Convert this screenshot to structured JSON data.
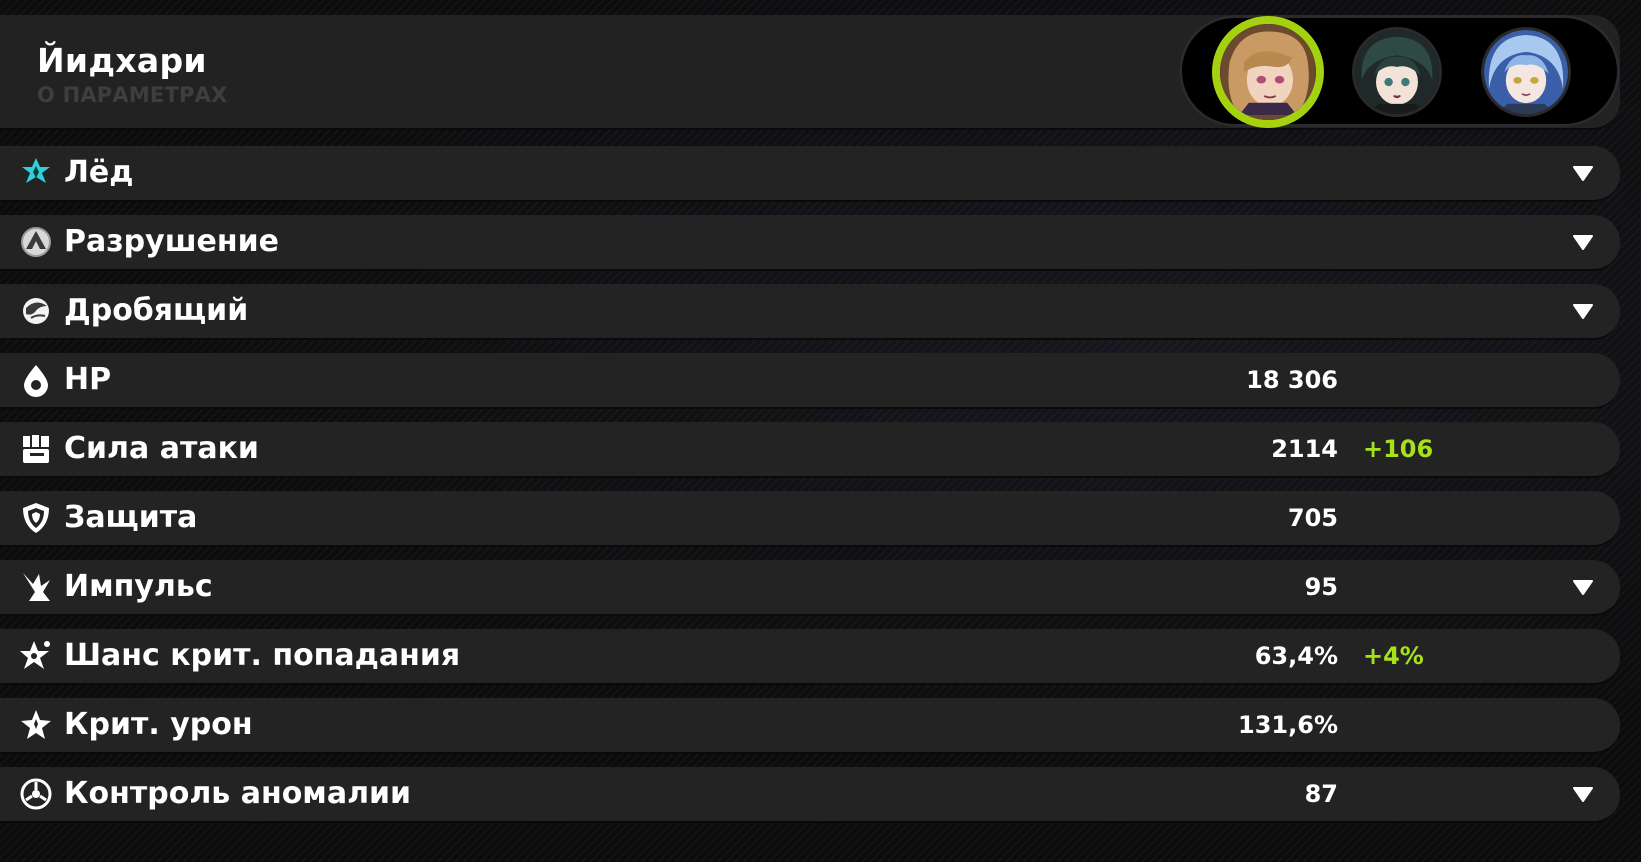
{
  "header": {
    "title": "Йидхари",
    "subtitle": "О ПАРАМЕТРАХ"
  },
  "agents": [
    {
      "name": "agent-1",
      "selected": true,
      "highlight_color": "#a4d110"
    },
    {
      "name": "agent-2",
      "selected": false
    },
    {
      "name": "agent-3",
      "selected": false
    }
  ],
  "stats": [
    {
      "icon": "ice-element-icon",
      "label": "Лёд",
      "value": "",
      "bonus": "",
      "expandable": true
    },
    {
      "icon": "rupture-specialty-icon",
      "label": "Разрушение",
      "value": "",
      "bonus": "",
      "expandable": true
    },
    {
      "icon": "strike-damage-icon",
      "label": "Дробящий",
      "value": "",
      "bonus": "",
      "expandable": true
    },
    {
      "icon": "hp-drop-icon",
      "label": "HP",
      "value": "18 306",
      "bonus": "",
      "expandable": false
    },
    {
      "icon": "fist-atk-icon",
      "label": "Сила атаки",
      "value": "2114",
      "bonus": "+106",
      "expandable": false
    },
    {
      "icon": "shield-icon",
      "label": "Защита",
      "value": "705",
      "bonus": "",
      "expandable": false
    },
    {
      "icon": "impact-icon",
      "label": "Импульс",
      "value": "95",
      "bonus": "",
      "expandable": true
    },
    {
      "icon": "crit-rate-icon",
      "label": "Шанс крит. попадания",
      "value": "63,4%",
      "bonus": "+4%",
      "expandable": false
    },
    {
      "icon": "crit-dmg-icon",
      "label": "Крит. урон",
      "value": "131,6%",
      "bonus": "",
      "expandable": false
    },
    {
      "icon": "anomaly-icon",
      "label": "Контроль аномалии",
      "value": "87",
      "bonus": "",
      "expandable": true
    }
  ],
  "colors": {
    "accent": "#a6e11c",
    "ice": "#2fd0d8",
    "row_bg": "#232324",
    "page_bg": "#0c0c0d"
  }
}
